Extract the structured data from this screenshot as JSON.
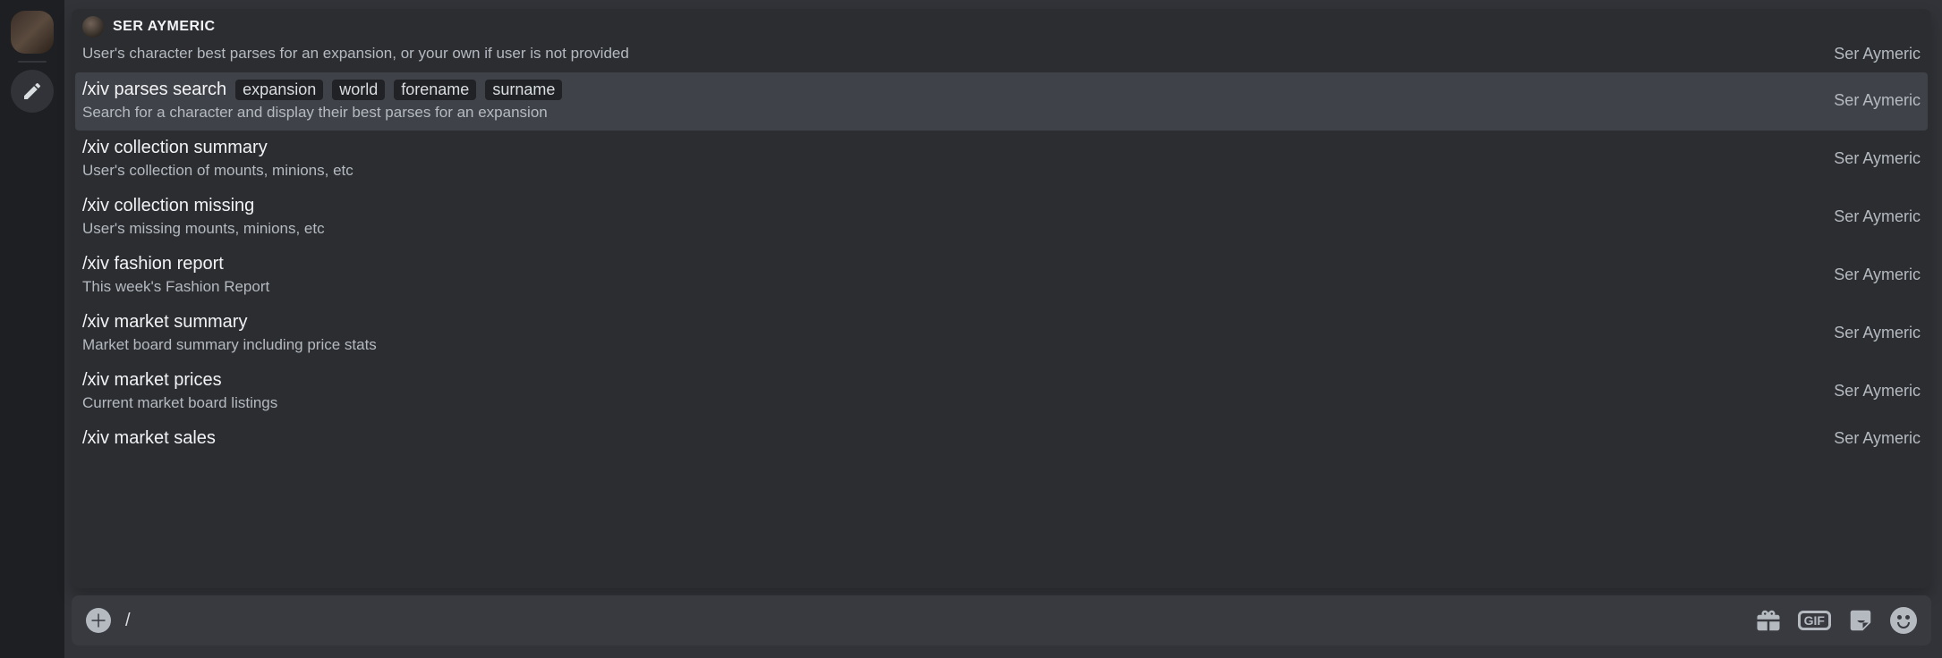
{
  "bot": {
    "name": "SER AYMERIC"
  },
  "source_label": "Ser Aymeric",
  "commands": [
    {
      "name": "",
      "params": [],
      "desc": "User's character best parses for an expansion, or your own if user is not provided",
      "selected": false,
      "partial_top": true
    },
    {
      "name": "/xiv parses search",
      "params": [
        "expansion",
        "world",
        "forename",
        "surname"
      ],
      "desc": "Search for a character and display their best parses for an expansion",
      "selected": true,
      "partial_top": false
    },
    {
      "name": "/xiv collection summary",
      "params": [],
      "desc": "User's collection of mounts, minions, etc",
      "selected": false,
      "partial_top": false
    },
    {
      "name": "/xiv collection missing",
      "params": [],
      "desc": "User's missing mounts, minions, etc",
      "selected": false,
      "partial_top": false
    },
    {
      "name": "/xiv fashion report",
      "params": [],
      "desc": "This week's Fashion Report",
      "selected": false,
      "partial_top": false
    },
    {
      "name": "/xiv market summary",
      "params": [],
      "desc": "Market board summary including price stats",
      "selected": false,
      "partial_top": false
    },
    {
      "name": "/xiv market prices",
      "params": [],
      "desc": "Current market board listings",
      "selected": false,
      "partial_top": false
    },
    {
      "name": "/xiv market sales",
      "params": [],
      "desc": "",
      "selected": false,
      "partial_top": false
    }
  ],
  "compose": {
    "value": "/"
  },
  "icons": {
    "gif": "GIF"
  }
}
